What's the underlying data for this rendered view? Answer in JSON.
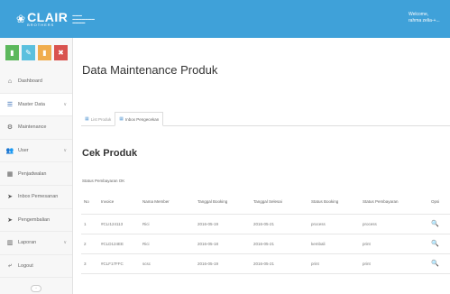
{
  "header": {
    "logo_mark": "❀",
    "logo_text": "CLAIR",
    "logo_sub": "BROTHERS",
    "logo_tag": "▬▬▬ ▬▬▬▬▬▬▬ ▬▬▬▬",
    "welcome": "Welcome,",
    "user": "rahma zelia-+..."
  },
  "quick_buttons": [
    {
      "icon": "▮",
      "color": "#5cb85c"
    },
    {
      "icon": "✎",
      "color": "#5bc0de"
    },
    {
      "icon": "▮",
      "color": "#f0ad4e"
    },
    {
      "icon": "✖",
      "color": "#d9534f"
    }
  ],
  "sidebar": {
    "items": [
      {
        "label": "Dashboard",
        "icon": "⌂"
      },
      {
        "label": "Master Data",
        "icon": "☰",
        "chev": "∨"
      },
      {
        "label": "Maintenance",
        "icon": "⚙"
      },
      {
        "label": "User",
        "icon": "👥",
        "chev": "∨"
      },
      {
        "label": "Penjadwalan",
        "icon": "▦"
      },
      {
        "label": "Inbox Pemesanan",
        "icon": "➤"
      },
      {
        "label": "Pengembalian",
        "icon": "➤"
      },
      {
        "label": "Laporan",
        "icon": "▥",
        "chev": "∨"
      },
      {
        "label": "Logout",
        "icon": "⤶"
      }
    ],
    "collapse": "◦"
  },
  "main": {
    "title": "Data Maintenance Produk",
    "tabs": [
      {
        "label": "List Produk",
        "icon": "▦"
      },
      {
        "label": "Inbox Pengecekan",
        "icon": "▦"
      }
    ],
    "section_title": "Cek Produk",
    "status_label": "Status Pembayaran OK"
  },
  "table": {
    "headers": [
      "No",
      "Invoice",
      "Nama Member",
      "Tanggal Booking",
      "Tanggal Selesai",
      "Status Booking",
      "Status Pembayaran",
      "Opsi"
    ],
    "rows": [
      [
        "1",
        "#CLI124113",
        "Rici",
        "2016-05-19",
        "2016-05-21",
        "process",
        "process"
      ],
      [
        "2",
        "#CLD124EE",
        "Rici",
        "2016-05-18",
        "2016-05-21",
        "kembali",
        "print"
      ],
      [
        "3",
        "#CLF17FFC",
        "scsc",
        "2016-05-19",
        "2016-05-21",
        "print",
        "print"
      ]
    ],
    "action_icon": "🔍"
  }
}
